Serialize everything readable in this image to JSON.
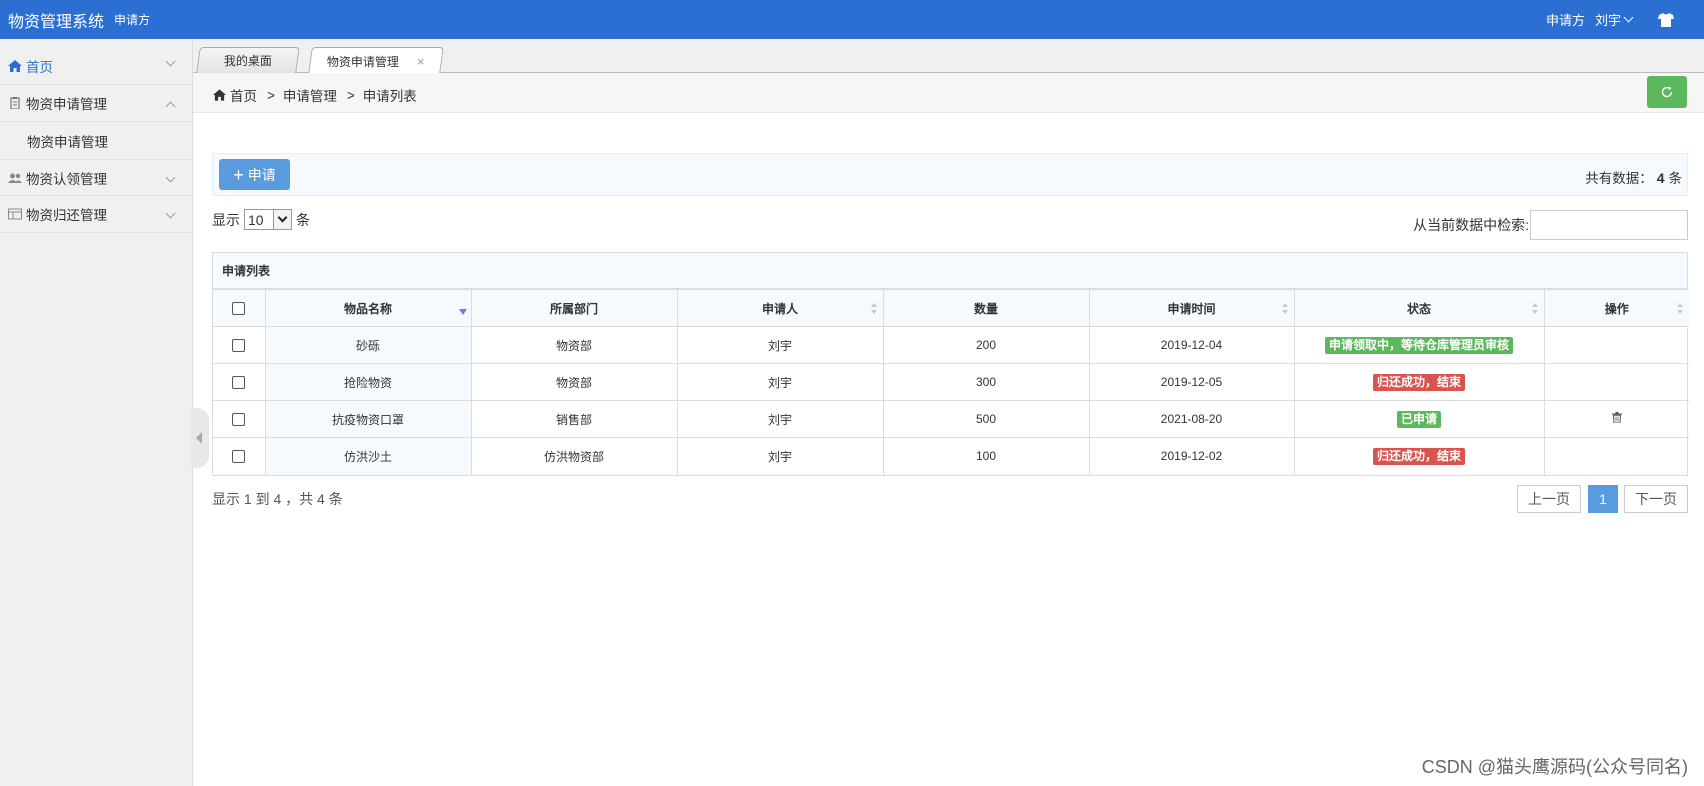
{
  "header": {
    "system_title": "物资管理系统",
    "role_tag": "申请方",
    "role": "申请方",
    "user": "刘宇"
  },
  "sidebar": {
    "items": [
      {
        "label": "首页"
      },
      {
        "label": "物资申请管理",
        "children": [
          {
            "label": "物资申请管理"
          }
        ]
      },
      {
        "label": "物资认领管理"
      },
      {
        "label": "物资归还管理"
      }
    ]
  },
  "tabs": [
    {
      "label": "我的桌面"
    },
    {
      "label": "物资申请管理",
      "close": "×"
    }
  ],
  "breadcrumb": {
    "home": "首页",
    "sep": ">",
    "level1": "申请管理",
    "level2": "申请列表"
  },
  "toolbar": {
    "add_label": "申请",
    "total_prefix": "共有数据：",
    "total_count": "4",
    "total_suffix": "条"
  },
  "length": {
    "prefix": "显示",
    "value": "10",
    "suffix": "条"
  },
  "search": {
    "label": "从当前数据中检索:",
    "placeholder": ""
  },
  "table": {
    "caption": "申请列表",
    "columns": [
      "物品名称",
      "所属部门",
      "申请人",
      "数量",
      "申请时间",
      "状态",
      "操作"
    ],
    "rows": [
      {
        "name": "砂砾",
        "dept": "物资部",
        "applicant": "刘宇",
        "qty": "200",
        "date": "2019-12-04",
        "status": "申请领取中，等待仓库管理员审核",
        "status_color": "#5cb85c",
        "action": ""
      },
      {
        "name": "抢险物资",
        "dept": "物资部",
        "applicant": "刘宇",
        "qty": "300",
        "date": "2019-12-05",
        "status": "归还成功，结束",
        "status_color": "#d9534f",
        "action": ""
      },
      {
        "name": "抗疫物资口罩",
        "dept": "销售部",
        "applicant": "刘宇",
        "qty": "500",
        "date": "2021-08-20",
        "status": "已申请",
        "status_color": "#5cb85c",
        "action": "trash-icon"
      },
      {
        "name": "仿洪沙土",
        "dept": "仿洪物资部",
        "applicant": "刘宇",
        "qty": "100",
        "date": "2019-12-02",
        "status": "归还成功，结束",
        "status_color": "#d9534f",
        "action": ""
      }
    ]
  },
  "info": "显示 1 到 4 ，共 4 条",
  "pagination": {
    "prev": "上一页",
    "current": "1",
    "next": "下一页"
  },
  "watermark": "CSDN @猫头鹰源码(公众号同名)",
  "colors": {
    "header": "#2a6fd1",
    "primary": "#5a9be0",
    "success": "#5cb85c",
    "danger": "#d9534f"
  }
}
